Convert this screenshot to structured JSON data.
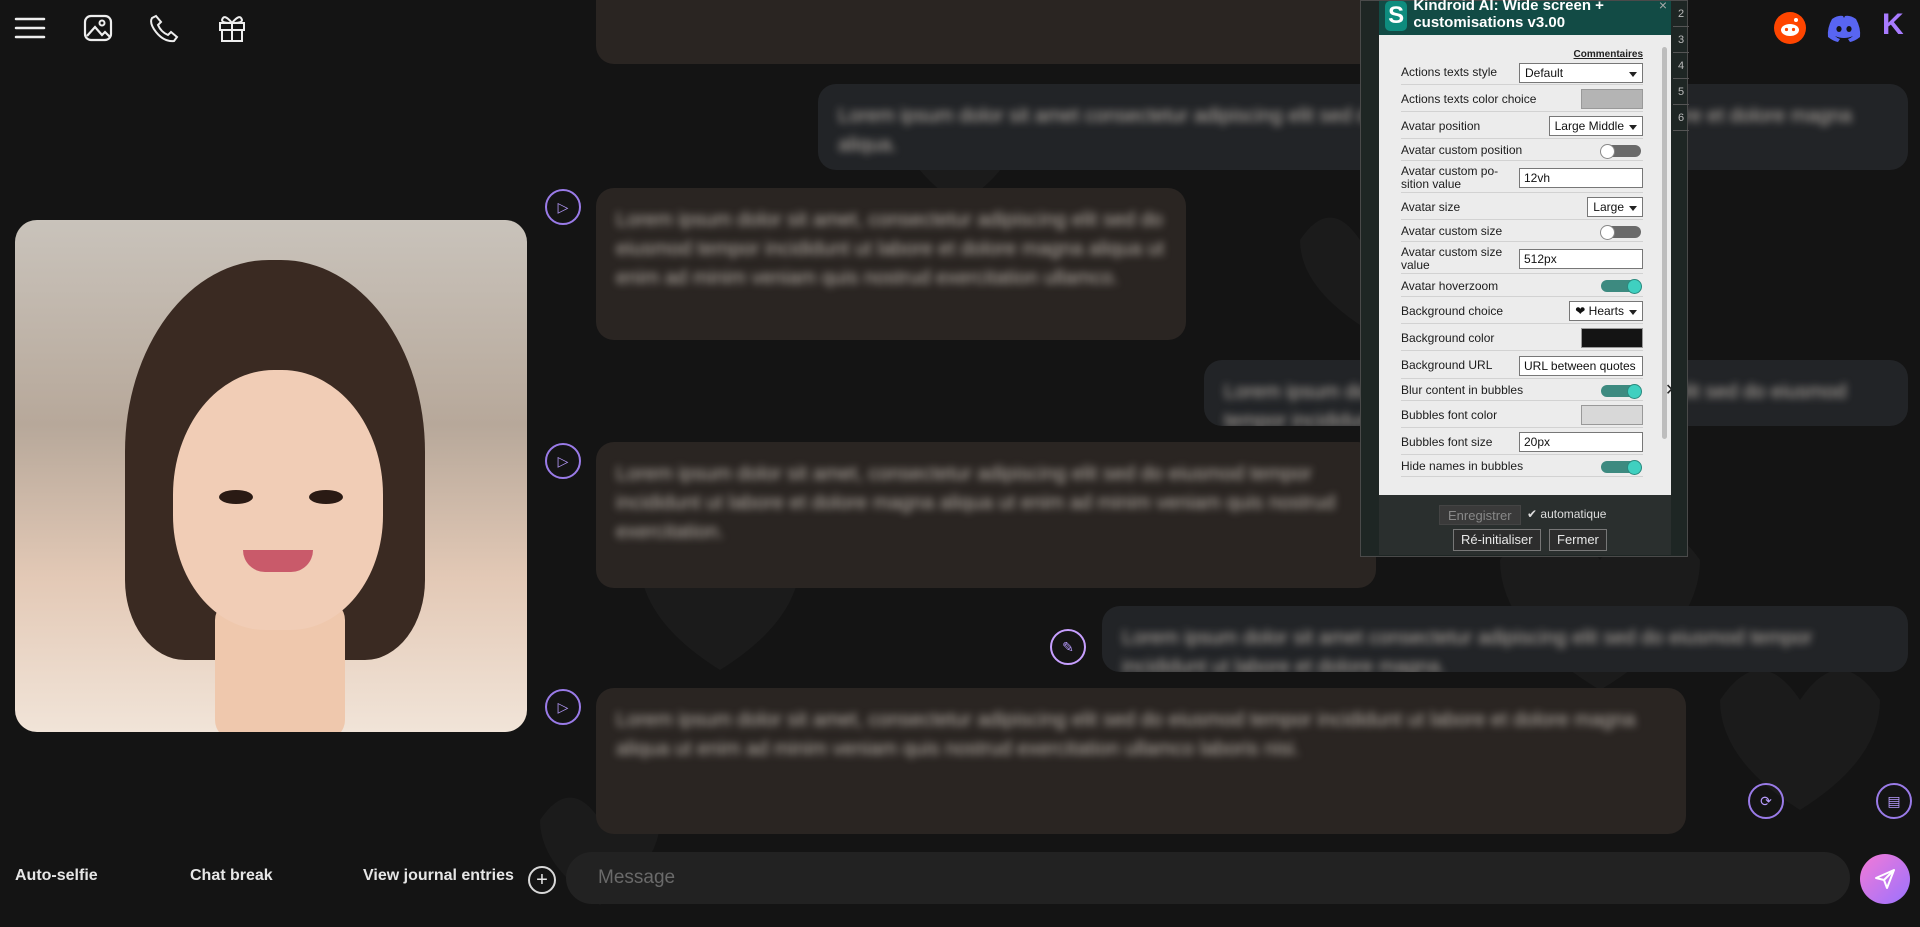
{
  "topbar": {
    "icons": [
      "menu-icon",
      "image-icon",
      "phone-icon",
      "gift-icon"
    ],
    "social_icons": [
      "reddit-icon",
      "discord-icon",
      "kindroid-logo"
    ],
    "kindroid_letter": "K"
  },
  "chat": {
    "messages": [
      {
        "role": "user",
        "text": "Lorem ipsum dolor sit amet consectetur adipiscing elit sed do eiusmod tempor incididunt ut labore et dolore magna aliqua."
      },
      {
        "role": "ai",
        "text": "Lorem ipsum dolor sit amet, consectetur adipiscing elit sed do eiusmod tempor incididunt ut labore et dolore magna aliqua ut enim ad minim veniam quis nostrud exercitation ullamco."
      },
      {
        "role": "user",
        "text": "Lorem ipsum dolor sit amet consectetur adipiscing elit sed do eiusmod tempor incididunt ut labore."
      },
      {
        "role": "ai",
        "text": "Lorem ipsum dolor sit amet, consectetur adipiscing elit sed do eiusmod tempor incididunt ut labore et dolore magna aliqua ut enim ad minim veniam quis nostrud exercitation."
      },
      {
        "role": "user",
        "text": "Lorem ipsum dolor sit amet consectetur adipiscing elit sed do eiusmod tempor incididunt ut labore et dolore magna."
      },
      {
        "role": "ai",
        "text": "Lorem ipsum dolor sit amet, consectetur adipiscing elit sed do eiusmod tempor incididunt ut labore et dolore magna aliqua ut enim ad minim veniam quis nostrud exercitation ullamco laboris nisi."
      }
    ]
  },
  "bottom": {
    "auto_selfie": "Auto-selfie",
    "chat_break": "Chat break",
    "journal": "View journal entries",
    "plus": "+",
    "message_placeholder": "Message"
  },
  "panel": {
    "logo": "S",
    "title": "Kindroid AI: Wide screen + customisations v3.00",
    "close": "×",
    "side_numbers": [
      "2",
      "3",
      "4",
      "5",
      "6"
    ],
    "comments": "Commentaires",
    "options": [
      {
        "label": "Actions texts style",
        "type": "select",
        "value": "Default"
      },
      {
        "label": "Actions texts color choice",
        "type": "color",
        "value": "#b4b4b4"
      },
      {
        "label": "Avatar position",
        "type": "select",
        "value": "Large Middle"
      },
      {
        "label": "Avatar custom position",
        "type": "toggle",
        "value": false
      },
      {
        "label": "Avatar custom po-\nsition value",
        "type": "input",
        "value": "12vh"
      },
      {
        "label": "Avatar size",
        "type": "select",
        "value": "Large"
      },
      {
        "label": "Avatar custom size",
        "type": "toggle",
        "value": false
      },
      {
        "label": "Avatar custom size value",
        "type": "input",
        "value": "512px"
      },
      {
        "label": "Avatar hoverzoom",
        "type": "toggle",
        "value": true
      },
      {
        "label": "Background choice",
        "type": "select",
        "value": "❤ Hearts"
      },
      {
        "label": "Background color",
        "type": "color",
        "value": "#141414"
      },
      {
        "label": "Background URL",
        "type": "input",
        "value": "URL between quotes"
      },
      {
        "label": "Blur content in bubbles",
        "type": "toggle",
        "value": true
      },
      {
        "label": "Bubbles font color",
        "type": "color",
        "value": "#d8d8d8"
      },
      {
        "label": "Bubbles font size",
        "type": "input",
        "value": "20px"
      },
      {
        "label": "Hide names in bubbles",
        "type": "toggle",
        "value": true
      }
    ],
    "x_mark": "✕",
    "save": "Enregistrer",
    "auto": "✔ automatique",
    "reset": "Ré-initialiser",
    "close_btn": "Fermer"
  },
  "colors": {
    "background": "#141414",
    "accent": "#9a7be8",
    "panel_header": "#124b45",
    "send_gradient": [
      "#f47ad6",
      "#9a72ff"
    ]
  }
}
